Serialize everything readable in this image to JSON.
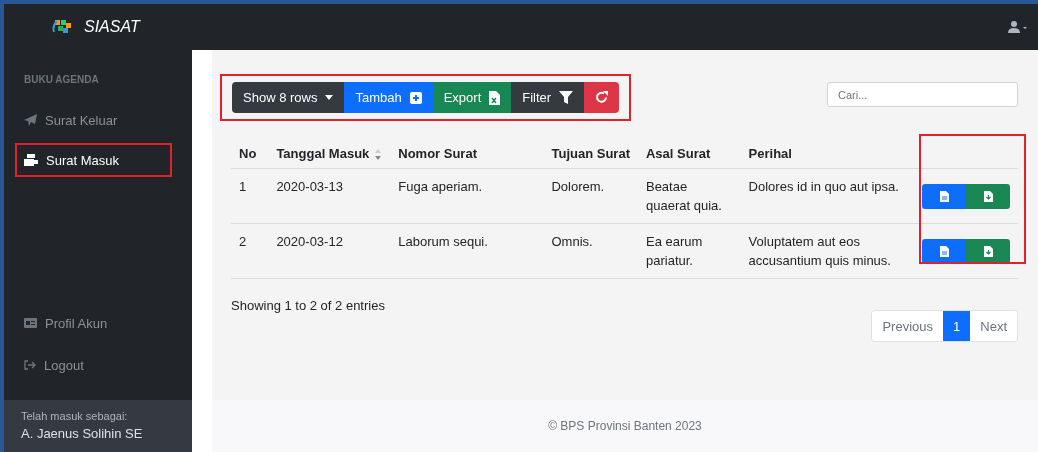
{
  "app": {
    "title": "SIASAT"
  },
  "sidebar": {
    "heading": "BUKU AGENDA",
    "items": [
      {
        "label": "Surat Keluar",
        "kind": "send",
        "selected": false,
        "highlighted": false
      },
      {
        "label": "Surat Masuk",
        "kind": "inbox",
        "selected": true,
        "highlighted": true
      }
    ],
    "bottom_items": [
      {
        "label": "Profil Akun",
        "kind": "card"
      },
      {
        "label": "Logout",
        "kind": "logout"
      }
    ],
    "user": {
      "caption": "Telah masuk sebagai:",
      "name": "A. Jaenus Solihin SE"
    }
  },
  "toolbar": {
    "highlighted": true,
    "buttons": [
      {
        "kind": "dropdown",
        "label": "Show 8 rows",
        "color": "#343a40"
      },
      {
        "kind": "add",
        "label": "Tambah",
        "color": "#0d6efd"
      },
      {
        "kind": "export",
        "label": "Export",
        "color": "#198754"
      },
      {
        "kind": "filter",
        "label": "Filter",
        "color": "#343a40"
      },
      {
        "kind": "reload",
        "color": "#dc3545"
      }
    ]
  },
  "search": {
    "placeholder": "Cari..."
  },
  "table": {
    "actions_highlighted": true,
    "columns": [
      "No",
      "Tanggal Masuk",
      "Nomor Surat",
      "Tujuan Surat",
      "Asal Surat",
      "Perihal"
    ],
    "rows": [
      {
        "cells": [
          "1",
          "2020-03-13",
          "Fuga aperiam.",
          "Dolorem.",
          "Beatae quaerat quia.",
          "Dolores id in quo aut ipsa."
        ]
      },
      {
        "cells": [
          "2",
          "2020-03-12",
          "Laborum sequi.",
          "Omnis.",
          "Ea earum pariatur.",
          "Voluptatem aut eos accusantium quis minus."
        ]
      }
    ]
  },
  "info": "Showing 1 to 2 of 2 entries",
  "pagination": [
    {
      "label": "Previous",
      "selected": false
    },
    {
      "label": "1",
      "selected": true
    },
    {
      "label": "Next",
      "selected": false
    }
  ],
  "footer": "© BPS Provinsi Banten 2023"
}
